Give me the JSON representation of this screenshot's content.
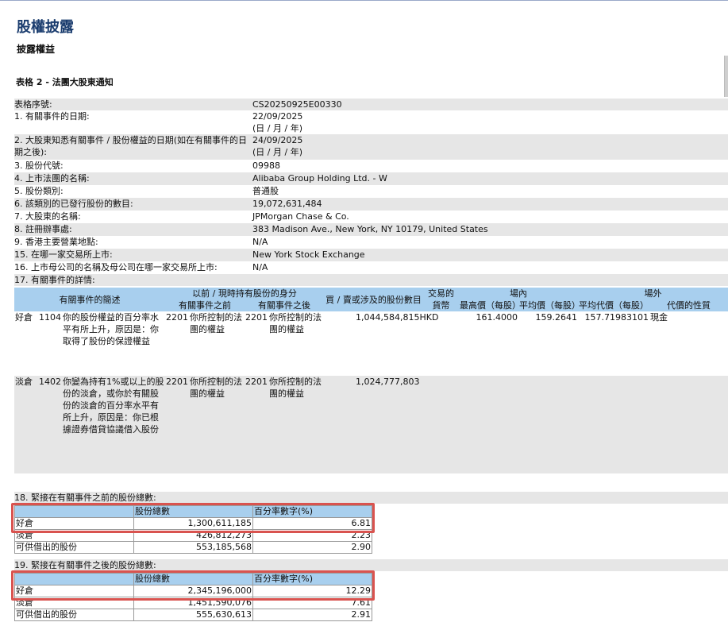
{
  "header": {
    "title": "股權披露",
    "subtitle": "披露權益"
  },
  "table_heading": "表格 2 - 法團大股東通知",
  "info_rows": [
    {
      "label": "表格序號:",
      "value": "CS20250925E00330"
    },
    {
      "label": "1. 有關事件的日期:",
      "value": "22/09/2025\n(日 / 月 / 年)"
    },
    {
      "label": "2. 大股東知悉有關事件 / 股份權益的日期(如在有關事件的日期之後):",
      "value": "24/09/2025\n(日 / 月 / 年)"
    },
    {
      "label": "3. 股份代號:",
      "value": "09988"
    },
    {
      "label": "4. 上市法團的名稱:",
      "value": "Alibaba Group Holding Ltd. - W"
    },
    {
      "label": "5. 股份類別:",
      "value": "普通股"
    },
    {
      "label": "6. 該類別的已發行股份的數目:",
      "value": "19,072,631,484"
    },
    {
      "label": "7. 大股東的名稱:",
      "value": "JPMorgan Chase & Co."
    },
    {
      "label": "8. 註冊辦事處:",
      "value": "383 Madison Ave., New York, NY 10179, United States"
    },
    {
      "label": "9. 香港主要營業地點:",
      "value": "N/A"
    },
    {
      "label": "15. 在哪一家交易所上市:",
      "value": "New York Stock Exchange"
    },
    {
      "label": "16. 上市母公司的名稱及母公司在哪一家交易所上市:",
      "value": "N/A"
    },
    {
      "label": "17. 有關事件的詳情:",
      "value": ""
    }
  ],
  "events_table": {
    "headers": {
      "description": "有關事件的簡述",
      "capacity": "以前 / 現時持有股份的身分",
      "before": "有關事件之前",
      "after": "有關事件之後",
      "shares": "買 / 賣或涉及的股份數目",
      "currency": "交易的貨幣",
      "onexchange": "場內",
      "high": "最高價（每股）",
      "avg": "平均價（每股）",
      "offexchange": "場外",
      "offavg": "平均代價（每股）",
      "consideration": "代價的性質"
    },
    "rows": [
      {
        "position": "好倉",
        "code": "1104",
        "desc": "你的股份權益的百分率水平有所上升，原因是：你取得了股份的保證權益",
        "cap_before_code": "2201",
        "cap_before": "你所控制的法團的權益",
        "cap_after_code": "2201",
        "cap_after": "你所控制的法團的權益",
        "shares": "1,044,584,815HKD",
        "high": "161.4000",
        "avg": "159.2641",
        "offavg": "157.71983101",
        "nature": "現金"
      },
      {
        "position": "淡倉",
        "code": "1402",
        "desc": "你變為持有1%或以上的股份的淡倉，或你於有關股份的淡倉的百分率水平有所上升，原因是：你已根據證券借貸協議借入股份",
        "cap_before_code": "2201",
        "cap_before": "你所控制的法團的權益",
        "cap_after_code": "2201",
        "cap_after": "你所控制的法團的權益",
        "shares": "1,024,777,803",
        "high": "",
        "avg": "",
        "offavg": "",
        "nature": ""
      }
    ]
  },
  "section18": {
    "title": "18. 緊接在有關事件之前的股份總數:",
    "col_total": "股份總數",
    "col_pct": "百分率數字(%)",
    "rows": [
      {
        "label": "好倉",
        "total": "1,300,611,185",
        "pct": "6.81"
      },
      {
        "label": "淡倉",
        "total": "426,812,273",
        "pct": "2.23"
      },
      {
        "label": "可供借出的股份",
        "total": "553,185,568",
        "pct": "2.90"
      }
    ]
  },
  "section19": {
    "title": "19. 緊接在有關事件之後的股份總數:",
    "col_total": "股份總數",
    "col_pct": "百分率數字(%)",
    "rows": [
      {
        "label": "好倉",
        "total": "2,345,196,000",
        "pct": "12.29"
      },
      {
        "label": "淡倉",
        "total": "1,451,590,076",
        "pct": "7.61"
      },
      {
        "label": "可供借出的股份",
        "total": "555,630,613",
        "pct": "2.91"
      }
    ]
  },
  "colors": {
    "title": "#1a3c6e",
    "header_blue": "#a8cfee",
    "shade": "#e6e6e6",
    "highlight": "#d9534f"
  }
}
